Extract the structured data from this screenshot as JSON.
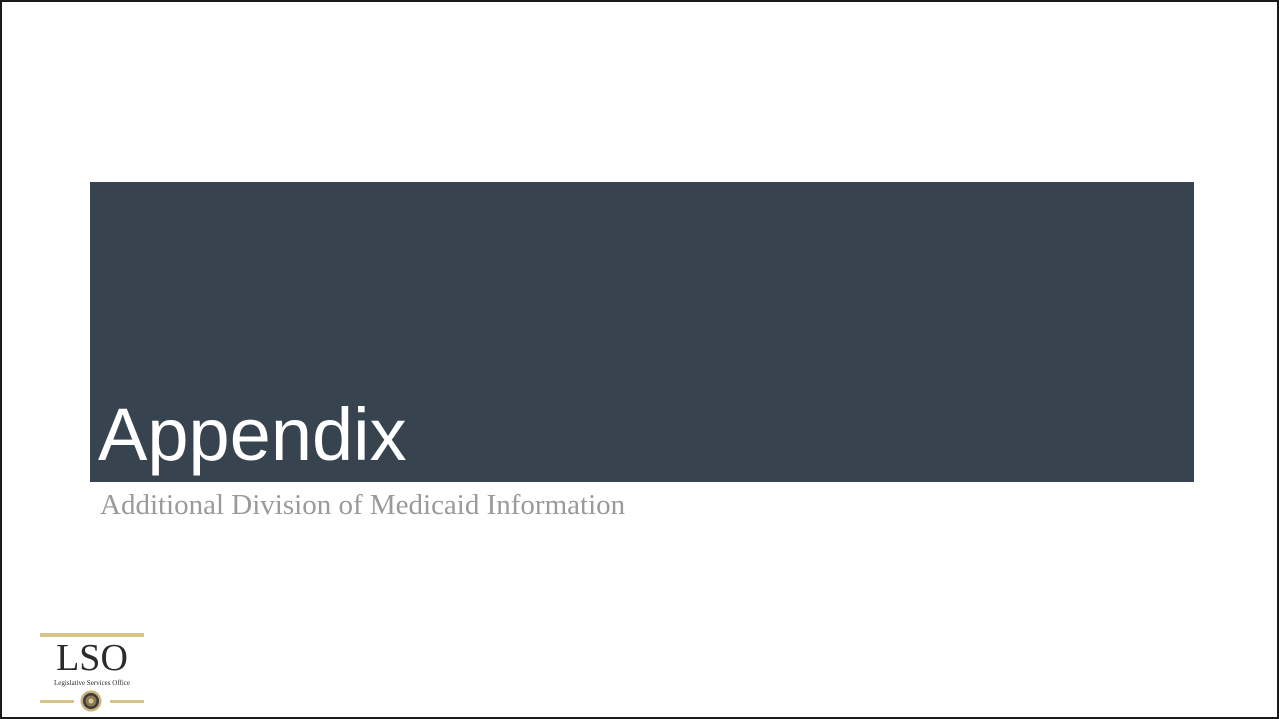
{
  "slide": {
    "title": "Appendix",
    "subtitle": "Additional Division of Medicaid Information",
    "band_color": "#37444f"
  },
  "logo": {
    "letters": "LSO",
    "caption": "Legislative Services Office",
    "accent_color": "#d6c48a",
    "seal_icon": "state-seal-icon"
  }
}
